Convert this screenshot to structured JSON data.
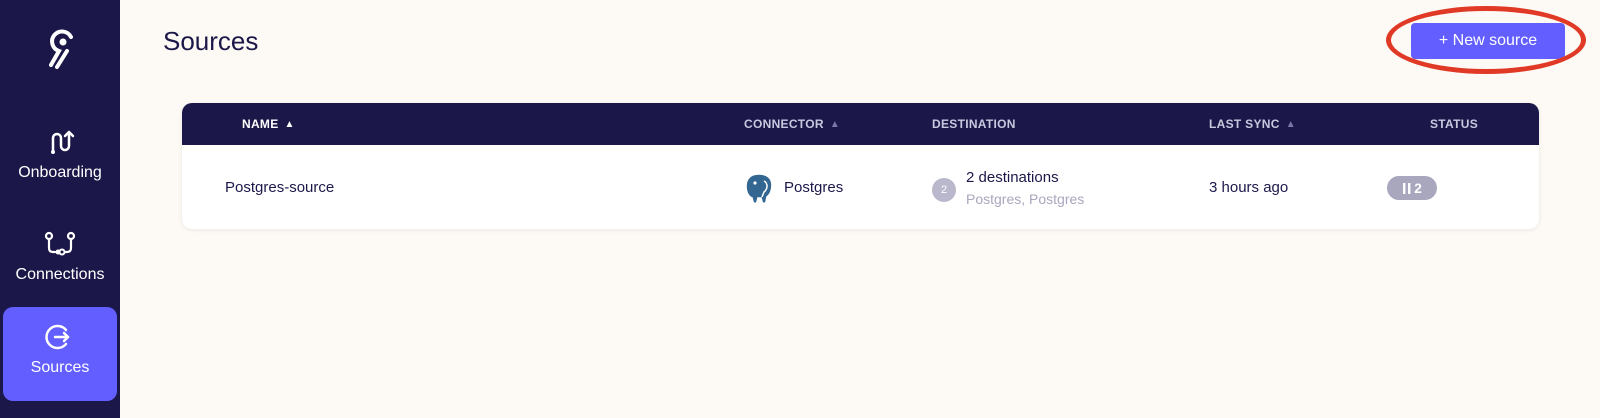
{
  "sidebar": {
    "logo_icon": "airbyte-logo-icon",
    "items": [
      {
        "label": "Onboarding",
        "icon": "onboarding-icon",
        "active": false
      },
      {
        "label": "Connections",
        "icon": "connections-icon",
        "active": false
      },
      {
        "label": "Sources",
        "icon": "sources-icon",
        "active": true
      }
    ]
  },
  "header": {
    "title": "Sources",
    "new_source_label": "+ New source"
  },
  "table": {
    "columns": {
      "name": "NAME",
      "connector": "CONNECTOR",
      "destination": "DESTINATION",
      "last_sync": "LAST SYNC",
      "status": "STATUS"
    },
    "rows": [
      {
        "name": "Postgres-source",
        "connector": "Postgres",
        "connector_icon": "postgres-elephant-icon",
        "destination_count": "2",
        "destination_title": "2 destinations",
        "destination_list": "Postgres, Postgres",
        "last_sync": "3 hours ago",
        "status_count": "2",
        "status_icon": "pause-icon"
      }
    ]
  },
  "colors": {
    "sidebar_bg": "#1b1849",
    "accent": "#625eff",
    "page_bg": "#fdf9f4",
    "highlight_ring": "#e03a26",
    "sort_active": "#ffffff",
    "sort_inactive": "#9d9bc0"
  }
}
